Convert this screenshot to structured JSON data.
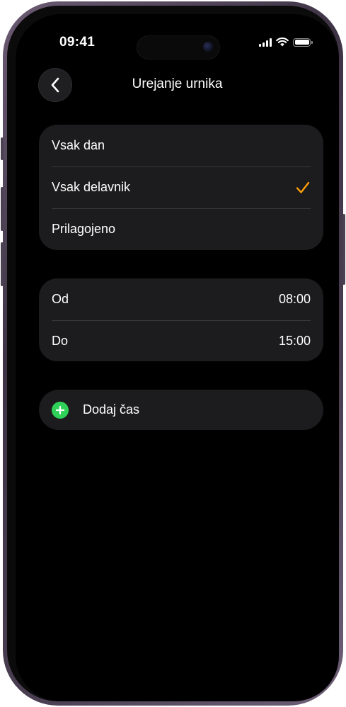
{
  "status_bar": {
    "time": "09:41"
  },
  "nav": {
    "title": "Urejanje urnika",
    "back_icon": "chevron-left-icon"
  },
  "repeat_options": [
    {
      "label": "Vsak dan",
      "selected": false
    },
    {
      "label": "Vsak delavnik",
      "selected": true
    },
    {
      "label": "Prilagojeno",
      "selected": false
    }
  ],
  "time_range": {
    "from_label": "Od",
    "from_value": "08:00",
    "to_label": "Do",
    "to_value": "15:00"
  },
  "add_time": {
    "label": "Dodaj čas",
    "icon": "plus-circle-icon"
  },
  "colors": {
    "accent_check": "#ff9f0a",
    "add_green": "#30d158",
    "cell_background": "#1c1c1e",
    "screen_background": "#000000"
  }
}
